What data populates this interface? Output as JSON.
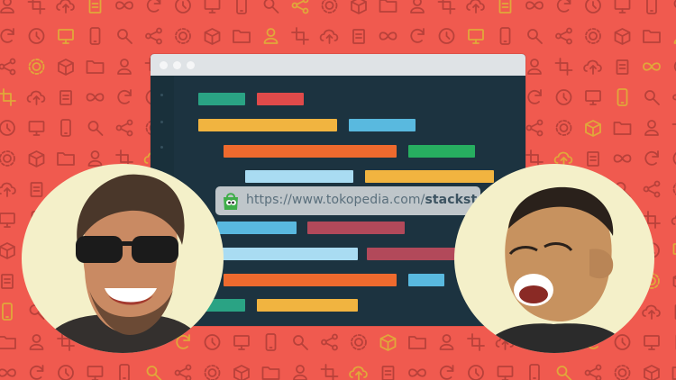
{
  "url_bar": {
    "url_prefix": "https://www.tokopedia.com/",
    "url_handle": "stackstore"
  },
  "colors": {
    "background": "#f05a4f",
    "pattern_icons": "#b8413a",
    "pattern_icons_gold": "#e0a83a",
    "editor_bg": "#1c3340",
    "code_teal": "#2aa384",
    "code_red": "#e04a4a",
    "code_yellow": "#f1b440",
    "code_blue": "#59b9df",
    "code_orange": "#ee6a2e",
    "code_green": "#27ae60",
    "code_lightblue": "#a9dcf2",
    "code_mauve": "#b2495a",
    "avatar_bg": "#f4f0c9"
  },
  "icons": [
    "person-icon",
    "crop-icon",
    "cloud-upload-icon",
    "clipboard-icon",
    "infinity-icon",
    "refresh-icon",
    "clock-icon",
    "monitor-icon",
    "phone-icon",
    "search-icon",
    "share-icon",
    "gear-icon",
    "box-icon",
    "folder-icon"
  ]
}
